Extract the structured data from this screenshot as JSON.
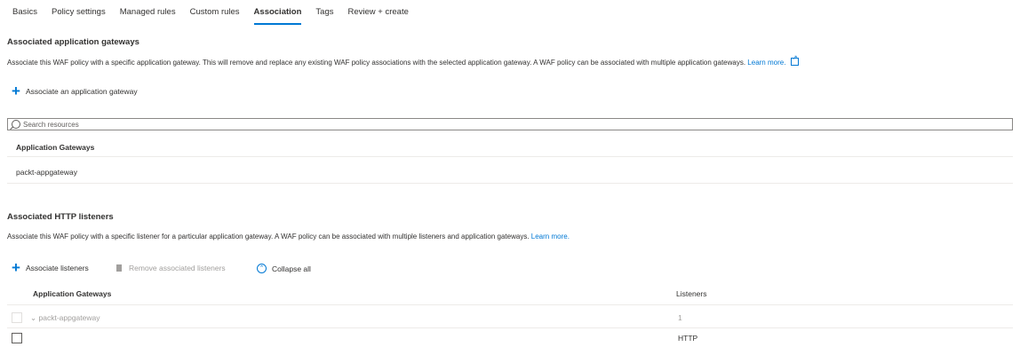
{
  "tabs": [
    "Basics",
    "Policy settings",
    "Managed rules",
    "Custom rules",
    "Association",
    "Tags",
    "Review + create"
  ],
  "active_tab": "Association",
  "gateways_section": {
    "title": "Associated application gateways",
    "description": "Associate this WAF policy with a specific application gateway. This will remove and replace any existing WAF policy associations with the selected application gateway. A WAF policy can be associated with multiple application gateways.",
    "learn_more": "Learn more.",
    "add_label": "Associate an application gateway",
    "search_placeholder": "Search resources",
    "column_header": "Application Gateways",
    "rows": [
      "packt-appgateway"
    ]
  },
  "listeners_section": {
    "title": "Associated HTTP listeners",
    "description": "Associate this WAF policy with a specific listener for a particular application gateway. A WAF policy can be associated with multiple listeners and application gateways.",
    "learn_more": "Learn more.",
    "associate_label": "Associate listeners",
    "remove_label": "Remove associated listeners",
    "collapse_label": "Collapse all",
    "col_gateways": "Application Gateways",
    "col_listeners": "Listeners",
    "group_row": {
      "name": "packt-appgateway",
      "listeners": "1"
    },
    "child_row": {
      "name": "",
      "listeners": "HTTP"
    }
  }
}
